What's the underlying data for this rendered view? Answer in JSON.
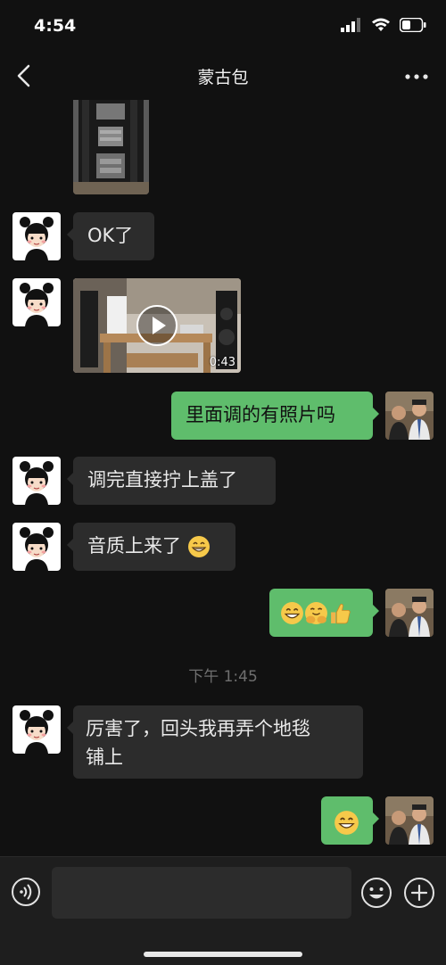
{
  "status": {
    "time": "4:54"
  },
  "nav": {
    "title": "蒙古包"
  },
  "messages": {
    "m1": "OK了",
    "video_duration": "0:43",
    "m3": "里面调的有照片吗",
    "m4": "调完直接拧上盖了",
    "m5": "音质上来了",
    "timestamp": "下午 1:45",
    "m7_line1": "厉害了，回头我再弄个地毯",
    "m7_line2": "铺上"
  },
  "input": {
    "placeholder": ""
  },
  "icons": {
    "back": "chevron-left-icon",
    "more": "more-dots-icon",
    "voice": "voice-icon",
    "emoji": "emoji-icon",
    "plus": "plus-icon",
    "grin": "grin-emoji",
    "hug": "hug-emoji",
    "thumbs": "thumbs-up-emoji"
  },
  "colors": {
    "background": "#111111",
    "bubble_left": "#2c2c2c",
    "bubble_right": "#5fbd6c"
  }
}
